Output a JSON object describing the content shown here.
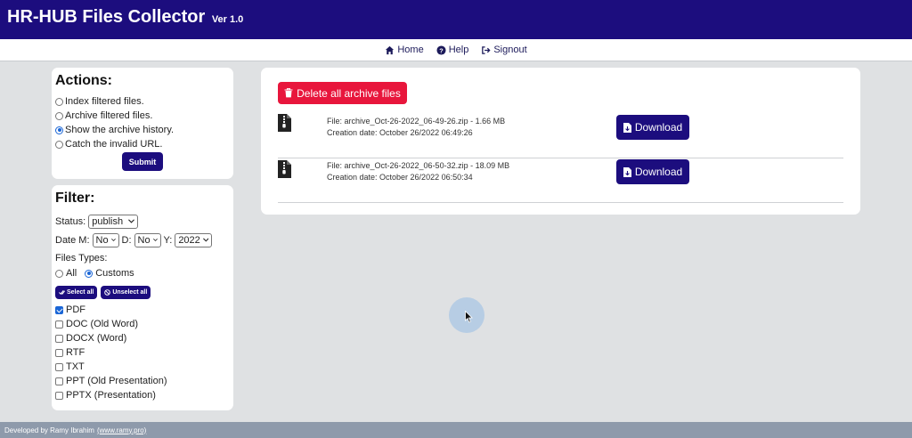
{
  "header": {
    "title": "HR-HUB Files Collector",
    "version": "Ver 1.0",
    "bg_color": "#1c0d7e"
  },
  "nav": {
    "items": [
      {
        "label": "Home",
        "icon": "home-icon"
      },
      {
        "label": "Help",
        "icon": "help-icon"
      },
      {
        "label": "Signout",
        "icon": "signout-icon"
      }
    ]
  },
  "actions": {
    "heading": "Actions:",
    "options": [
      {
        "label": "Index filtered files.",
        "selected": false
      },
      {
        "label": "Archive filtered files.",
        "selected": false
      },
      {
        "label": "Show the archive history.",
        "selected": true
      },
      {
        "label": "Catch the invalid URL.",
        "selected": false
      }
    ],
    "submit_label": "Submit"
  },
  "filter": {
    "heading": "Filter:",
    "status_label": "Status:",
    "status_value": "publish",
    "date_label": "Date M:",
    "month_value": "No",
    "day_label": "D:",
    "day_value": "No",
    "year_label": "Y:",
    "year_value": "2022",
    "file_types_label": "Files Types:",
    "mode_all": "All",
    "mode_customs": "Customs",
    "mode_selected": "Customs",
    "select_all_label": "Select all",
    "unselect_all_label": "Unselect all",
    "types": [
      {
        "label": "PDF",
        "checked": true
      },
      {
        "label": "DOC (Old Word)",
        "checked": false
      },
      {
        "label": "DOCX (Word)",
        "checked": false
      },
      {
        "label": "RTF",
        "checked": false
      },
      {
        "label": "TXT",
        "checked": false
      },
      {
        "label": "PPT (Old Presentation)",
        "checked": false
      },
      {
        "label": "PPTX (Presentation)",
        "checked": false
      }
    ]
  },
  "main": {
    "delete_label": "Delete all archive files",
    "delete_color": "#e8163c",
    "archives": [
      {
        "file": "File: archive_Oct-26-2022_06-49-26.zip - 1.66 MB",
        "created": "Creation date: October 26/2022 06:49:26",
        "download_label": "Download"
      },
      {
        "file": "File: archive_Oct-26-2022_06-50-32.zip - 18.09 MB",
        "created": "Creation date: October 26/2022 06:50:34",
        "download_label": "Download"
      }
    ]
  },
  "footer": {
    "text": "Developed by Ramy Ibrahim",
    "link": "(www.ramy.pro)"
  }
}
